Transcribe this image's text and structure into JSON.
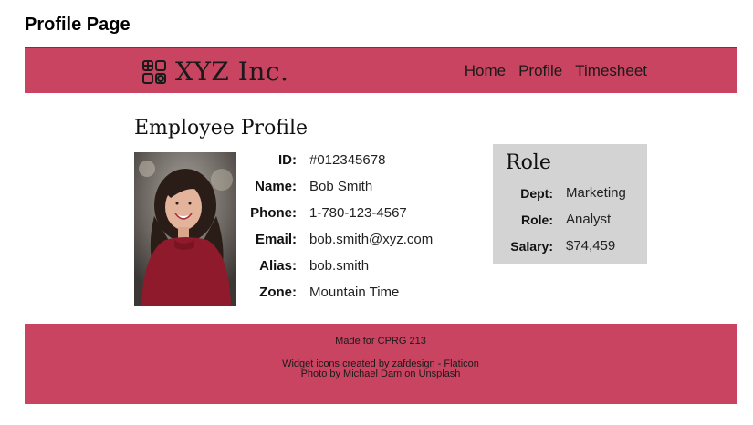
{
  "page": {
    "heading": "Profile Page"
  },
  "navbar": {
    "brand_name": "XYZ Inc.",
    "brand_icon": "widget-icon",
    "links": [
      {
        "label": "Home"
      },
      {
        "label": "Profile"
      },
      {
        "label": "Timesheet"
      }
    ],
    "color": "#c84460"
  },
  "profile": {
    "title": "Employee Profile",
    "fields": [
      {
        "label": "ID:",
        "value": "#012345678"
      },
      {
        "label": "Name:",
        "value": "Bob Smith"
      },
      {
        "label": "Phone:",
        "value": "1-780-123-4567"
      },
      {
        "label": "Email:",
        "value": "bob.smith@xyz.com"
      },
      {
        "label": "Alias:",
        "value": "bob.smith"
      },
      {
        "label": "Zone:",
        "value": "Mountain Time"
      }
    ]
  },
  "role": {
    "title": "Role",
    "fields": [
      {
        "label": "Dept:",
        "value": "Marketing"
      },
      {
        "label": "Role:",
        "value": "Analyst"
      },
      {
        "label": "Salary:",
        "value": "$74,459"
      }
    ],
    "background": "#d3d3d3"
  },
  "footer": {
    "made_for": "Made for CPRG 213",
    "credits_icons": "Widget icons created by zafdesign - Flaticon",
    "credits_photo": "Photo by Michael Dam on Unsplash"
  }
}
